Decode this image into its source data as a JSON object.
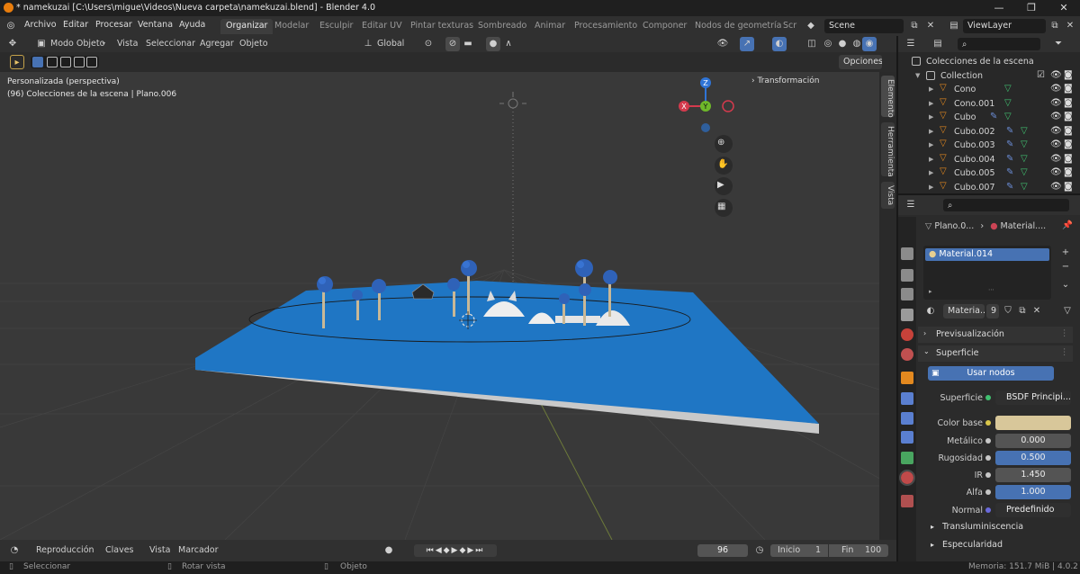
{
  "titlebar": {
    "title": "* namekuzai [C:\\Users\\migue\\Videos\\Nueva carpeta\\namekuzai.blend] - Blender 4.0",
    "minimize": "—",
    "maximize": "❐",
    "close": "✕"
  },
  "menu": [
    "Archivo",
    "Editar",
    "Procesar",
    "Ventana",
    "Ayuda"
  ],
  "workspaces": [
    "Organizar",
    "Modelar",
    "Esculpir",
    "Editar UV",
    "Pintar texturas",
    "Sombreado",
    "Animar",
    "Procesamiento",
    "Componer",
    "Nodos de geometría",
    "Scr"
  ],
  "active_workspace": "Organizar",
  "scene_name": "Scene",
  "view_layer": "ViewLayer",
  "viewport_header": {
    "mode": "Modo Objeto",
    "menus": [
      "Vista",
      "Seleccionar",
      "Agregar",
      "Objeto"
    ],
    "orientation": "Global",
    "options": "Opciones"
  },
  "viewport": {
    "view_name": "Personalizada (perspectiva)",
    "info": "(96) Colecciones de la escena | Plano.006",
    "transform_panel": "Transformación",
    "gizmo_axes": [
      "Z",
      "Y",
      "X"
    ]
  },
  "n_panel_tabs": [
    "Elemento",
    "Herramienta",
    "Vista"
  ],
  "outliner": {
    "root": "Colecciones de la escena",
    "collection": "Collection",
    "items": [
      "Cono",
      "Cono.001",
      "Cubo",
      "Cubo.002",
      "Cubo.003",
      "Cubo.004",
      "Cubo.005",
      "Cubo.007"
    ]
  },
  "properties": {
    "breadcrumb_object": "Plano.0...",
    "breadcrumb_material": "Material....",
    "material_slot": "Material.014",
    "material_name": "Materia...",
    "user_count": "9",
    "sections": {
      "preview": "Previsualización",
      "surface": "Superficie",
      "use_nodes": "Usar nodos",
      "translucency": "Transluminiscencia",
      "specular": "Especularidad"
    },
    "fields": [
      {
        "label": "Superficie",
        "value": "BSDF Principi..."
      },
      {
        "label": "Color base",
        "value": ""
      },
      {
        "label": "Metálico",
        "value": "0.000"
      },
      {
        "label": "Rugosidad",
        "value": "0.500"
      },
      {
        "label": "IR",
        "value": "1.450"
      },
      {
        "label": "Alfa",
        "value": "1.000"
      },
      {
        "label": "Normal",
        "value": "Predefinido"
      }
    ],
    "base_color": "#d8c79a"
  },
  "timeline": {
    "menus": [
      "Reproducción",
      "Claves",
      "Vista",
      "Marcador"
    ],
    "current_frame": "96",
    "start_label": "Inicio",
    "start": "1",
    "end_label": "Fin",
    "end": "100"
  },
  "status": {
    "select": "Seleccionar",
    "rotate": "Rotar vista",
    "object": "Objeto",
    "memory": "Memoria: 151.7 MiB | 4.0.2"
  },
  "colors": {
    "accent": "#4772b3",
    "water": "#1d77c4",
    "mushroom_cap": "#2f62b8"
  }
}
